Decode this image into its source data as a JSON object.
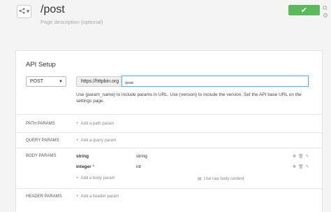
{
  "header": {
    "title": "/post",
    "description_placeholder": "Page description (optional)",
    "share_icon": "share-icon",
    "save_icon": "✔",
    "external_icon": "⧉",
    "settings_icon": "⚙"
  },
  "api_setup": {
    "title": "API Setup",
    "method": "POST",
    "base_url": "https://httpbin.org",
    "path": "/post",
    "help_text": "Use {param_name} to include params in URL. Use {version} to include the version. Set the API base URL on the settings page."
  },
  "path_params": {
    "label": "PATH PARAMS",
    "add_label": "Add a path param"
  },
  "query_params": {
    "label": "QUERY PARAMS",
    "add_label": "Add a query param"
  },
  "body_params": {
    "label": "BODY PARAMS",
    "items": [
      {
        "name": "string",
        "required": false,
        "type": "string"
      },
      {
        "name": "integer",
        "required": true,
        "required_mark": "*",
        "type": "int"
      }
    ],
    "add_label": "Add a body param",
    "raw_label": "Use raw body content"
  },
  "header_params": {
    "label": "HEADER PARAMS",
    "add_label": "Add a header param"
  },
  "colors": {
    "accent": "#5cb85c",
    "focus": "#66afe9",
    "required": "#d9534f"
  }
}
